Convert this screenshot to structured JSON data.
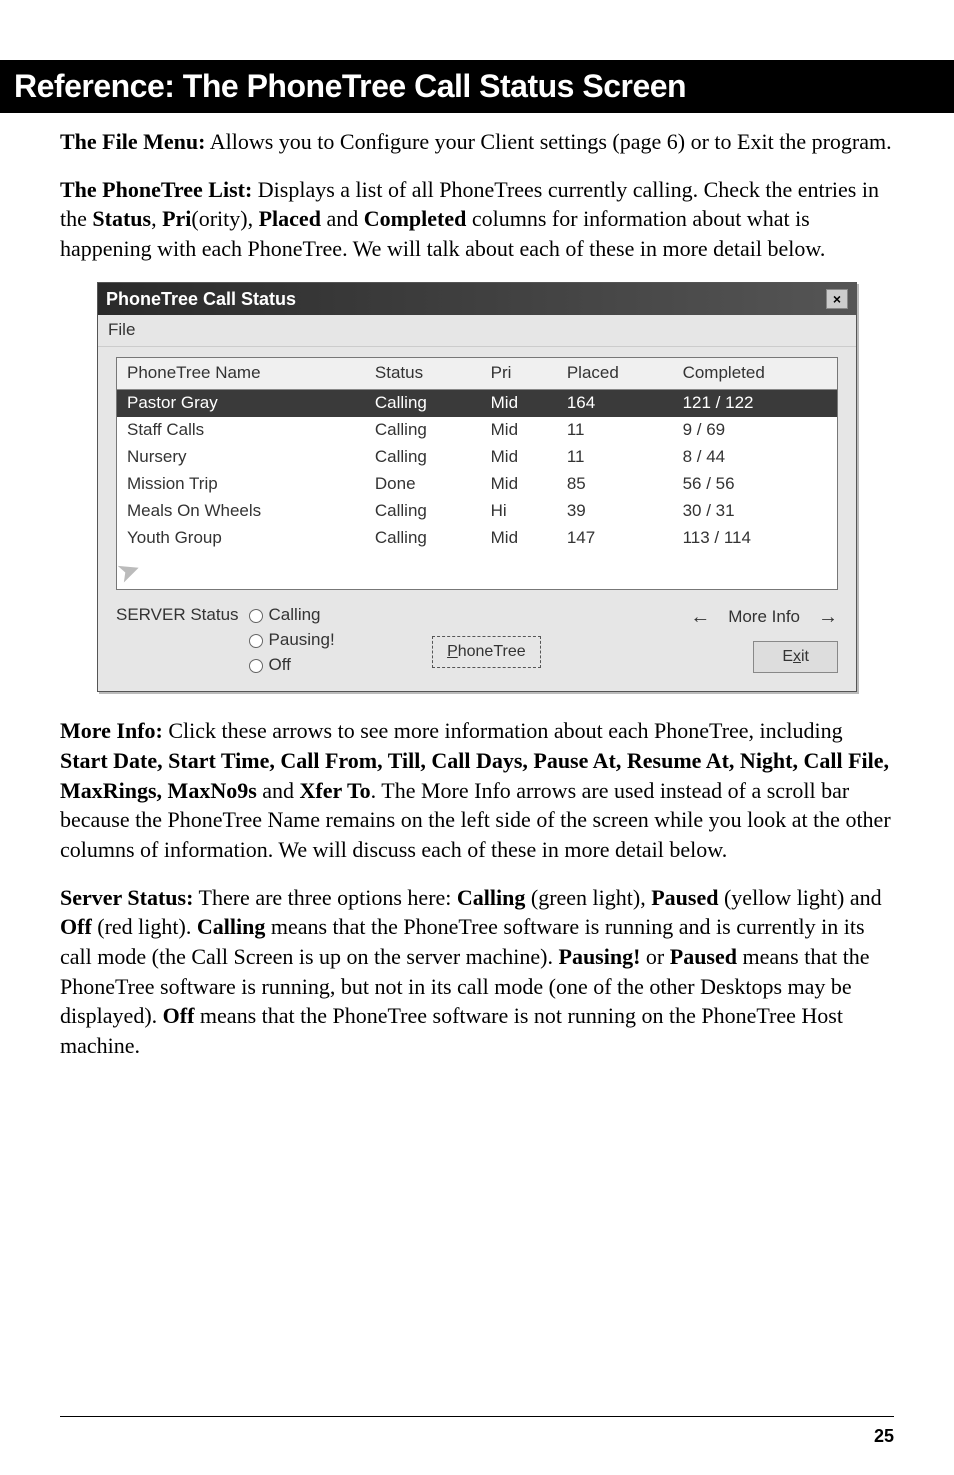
{
  "header": {
    "title": "Reference: The PhoneTree Call Status Screen"
  },
  "paragraphs": {
    "p1": {
      "lead": "The File Menu:",
      "rest": " Allows you to Configure your Client settings (page 6) or to Exit the program."
    },
    "p2": {
      "lead": "The PhoneTree List:",
      "rest1": " Displays a list of all PhoneTrees currently calling. Check the entries in the ",
      "b1": "Status",
      "mid1": ", ",
      "b2": "Pri",
      "mid2": "(ority), ",
      "b3": "Placed",
      "mid3": " and ",
      "b4": "Completed",
      "rest2": " columns for information about what is happening with each PhoneTree. We will talk about each of these in more detail below."
    },
    "p3": {
      "lead": "More Info:",
      "rest1": " Click these arrows to see more information about each PhoneTree, including ",
      "b1": "Start Date, Start Time, Call From, Till, Call Days, Pause At, Resume At, Night, Call File, MaxRings, MaxNo9s",
      "mid1": " and ",
      "b2": "Xfer To",
      "rest2": ". The More Info arrows are used instead of a scroll bar because the PhoneTree Name remains on the left side of the screen while you look at the other columns of information. We will discuss each of these in more detail below."
    },
    "p4": {
      "lead": "Server Status:",
      "rest1": " There are three options here: ",
      "b1": "Calling",
      "mid1": " (green light), ",
      "b2": "Paused",
      "mid2": " (yellow light) and ",
      "b3": "Off",
      "mid3": " (red light). ",
      "b4": "Calling",
      "rest2": " means that the PhoneTree software is running and is currently in its call mode (the Call Screen is up on the server machine). ",
      "b5": "Pausing!",
      "mid4": " or ",
      "b6": "Paused",
      "rest3": " means that the PhoneTree software is running, but not in its call mode (one of the other Desktops may be displayed). ",
      "b7": "Off",
      "rest4": " means that the PhoneTree software is not running on the PhoneTree Host machine."
    }
  },
  "dialog": {
    "title": "PhoneTree Call Status",
    "close": "×",
    "menu": {
      "file": "File"
    },
    "columns": {
      "name": "PhoneTree Name",
      "status": "Status",
      "pri": "Pri",
      "placed": "Placed",
      "completed": "Completed"
    },
    "rows": [
      {
        "name": "Pastor Gray",
        "status": "Calling",
        "pri": "Mid",
        "placed": "164",
        "completed": "121 / 122",
        "selected": true
      },
      {
        "name": "Staff Calls",
        "status": "Calling",
        "pri": "Mid",
        "placed": "11",
        "completed": "9 / 69",
        "selected": false
      },
      {
        "name": "Nursery",
        "status": "Calling",
        "pri": "Mid",
        "placed": "11",
        "completed": "8 / 44",
        "selected": false
      },
      {
        "name": "Mission Trip",
        "status": "Done",
        "pri": "Mid",
        "placed": "85",
        "completed": "56 / 56",
        "selected": false
      },
      {
        "name": "Meals On Wheels",
        "status": "Calling",
        "pri": "Hi",
        "placed": "39",
        "completed": "30 / 31",
        "selected": false
      },
      {
        "name": "Youth Group",
        "status": "Calling",
        "pri": "Mid",
        "placed": "147",
        "completed": "113 / 114",
        "selected": false
      }
    ],
    "server": {
      "label": "SERVER Status",
      "options": {
        "calling": "Calling",
        "pausing": "Pausing!",
        "off": "Off"
      }
    },
    "buttons": {
      "phonetree_prefix": "P",
      "phonetree_rest": "honeTree",
      "moreinfo": "More Info",
      "left_arrow": "←",
      "right_arrow": "→",
      "exit_prefix": "E",
      "exit_ul": "x",
      "exit_rest": "it"
    }
  },
  "footer": {
    "page_number": "25"
  }
}
